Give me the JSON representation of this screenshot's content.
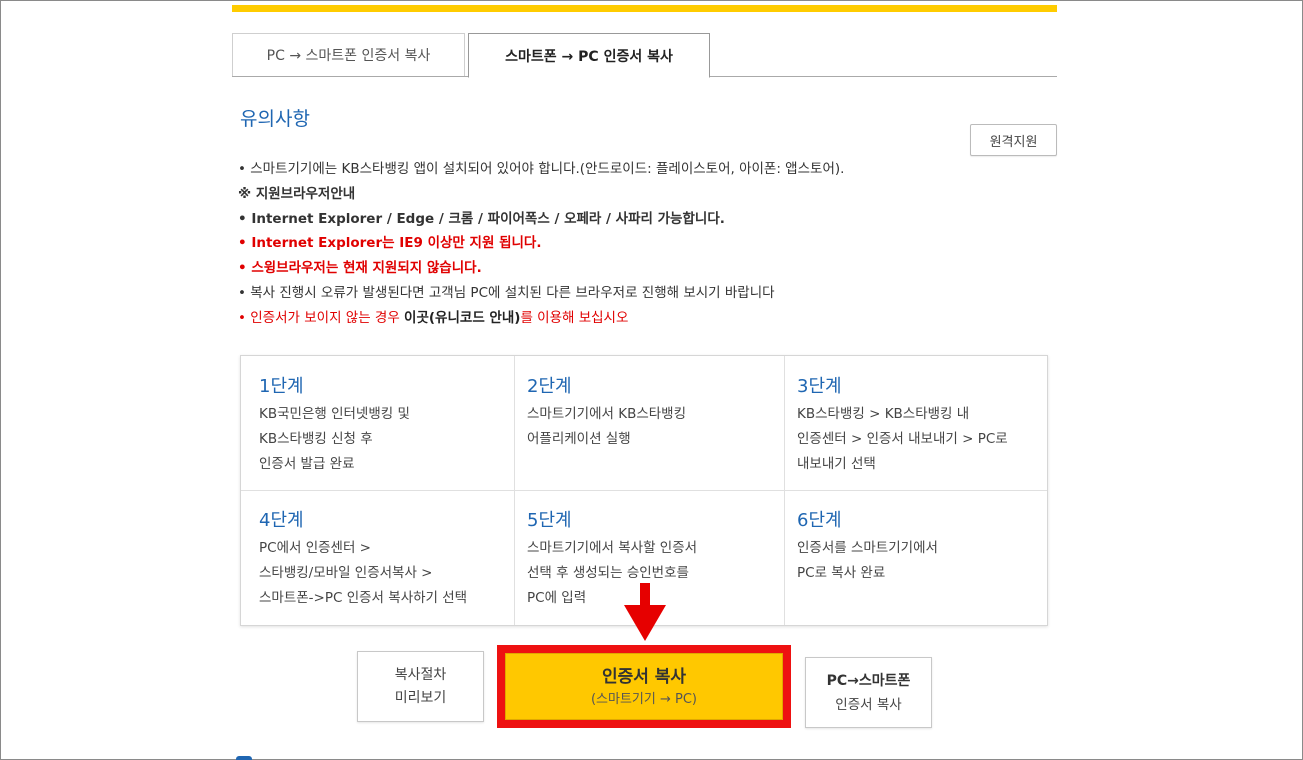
{
  "tabs": [
    {
      "label": "PC → 스마트폰 인증서 복사"
    },
    {
      "label": "스마트폰 → PC 인증서 복사"
    }
  ],
  "notice": {
    "title": "유의사항",
    "remote_label": "원격지원",
    "line1": "• 스마트기기에는 KB스타뱅킹 앱이 설치되어 있어야 합니다.(안드로이드: 플레이스토어, 아이폰: 앱스토어).",
    "line2": "※ 지원브라우저안내",
    "line3": "• Internet Explorer / Edge / 크롬 / 파이어폭스 / 오페라 / 사파리 가능합니다.",
    "line4": "• Internet Explorer는 IE9 이상만 지원 됩니다.",
    "line5": "• 스윙브라우저는 현재 지원되지 않습니다.",
    "line6": "• 복사 진행시 오류가 발생된다면 고객님 PC에 설치된 다른 브라우저로 진행해 보시기 바랍니다",
    "line7_prefix": "• 인증서가 보이지 않는 경우 ",
    "line7_link": "이곳(유니코드 안내)",
    "line7_suffix": "를 이용해 보십시오"
  },
  "steps": [
    {
      "title": "1단계",
      "lines": [
        "KB국민은행 인터넷뱅킹 및",
        "KB스타뱅킹 신청 후",
        "인증서 발급 완료"
      ]
    },
    {
      "title": "2단계",
      "lines": [
        "스마트기기에서 KB스타뱅킹",
        "어플리케이션 실행"
      ]
    },
    {
      "title": "3단계",
      "lines": [
        "KB스타뱅킹 > KB스타뱅킹 내",
        "인증센터 > 인증서 내보내기 > PC로",
        "내보내기 선택"
      ]
    },
    {
      "title": "4단계",
      "lines": [
        "PC에서 인증센터 >",
        "스타뱅킹/모바일 인증서복사 >",
        "스마트폰->PC 인증서 복사하기 선택"
      ]
    },
    {
      "title": "5단계",
      "lines": [
        "스마트기기에서 복사할 인증서",
        "선택 후 생성되는 승인번호를",
        "PC에 입력"
      ]
    },
    {
      "title": "6단계",
      "lines": [
        "인증서를 스마트기기에서",
        "PC로 복사 완료"
      ]
    }
  ],
  "buttons": {
    "preview_line1": "복사절차",
    "preview_line2": "미리보기",
    "copy_main": "인증서 복사",
    "copy_sub": "(스마트기기 → PC)",
    "pc_main": "PC→스마트폰",
    "pc_sub": "인증서 복사"
  },
  "colors": {
    "accent_yellow": "#ffcc00",
    "highlight_red": "#ee1111",
    "title_blue": "#1f66b2"
  }
}
